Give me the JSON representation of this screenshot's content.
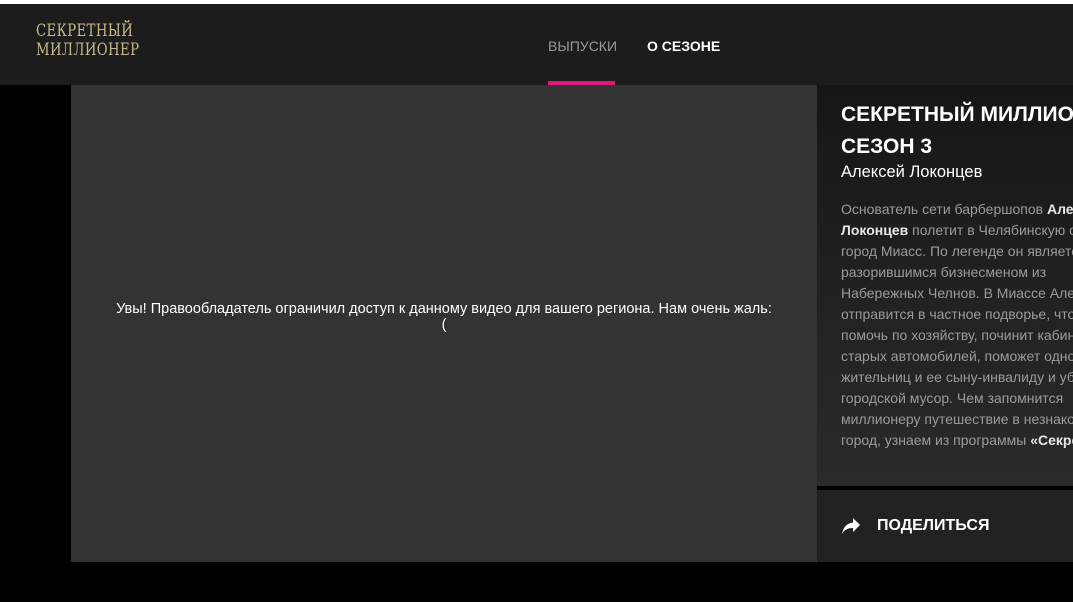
{
  "header": {
    "logo_line1": "СЕКРЕТНЫЙ",
    "logo_line2": "МИЛЛИОНЕР",
    "tabs": [
      {
        "label": "ВЫПУСКИ",
        "active": true
      },
      {
        "label": "О СЕЗОНЕ",
        "active": false
      }
    ]
  },
  "player": {
    "message": "Увы! Правообладатель ограничил доступ к данному видео для вашего региона. Нам очень жаль:("
  },
  "info": {
    "title_line1": "СЕКРЕТНЫЙ МИЛЛИОНЕР.",
    "title_line2": "СЕЗОН 3",
    "subtitle": "Алексей Локонцев",
    "description_lines": [
      {
        "plain": "Основатель сети барбершопов ",
        "bold": "Алексей"
      },
      {
        "plain": "",
        "bold": "Локонцев",
        "rest": " полетит в Челябинскую область, в"
      },
      {
        "plain": "город Миасс. По легенде он является"
      },
      {
        "plain": "разорившимся бизнесменом из"
      },
      {
        "plain": "Набережных Челнов. В Миассе Алексей"
      },
      {
        "plain": "отправится в частное подворье, чтобы"
      },
      {
        "plain": "помочь по хозяйству, починит кабины"
      },
      {
        "plain": "старых автомобилей, поможет одной из"
      },
      {
        "plain": "жительниц и ее сыну-инвалиду и уберет"
      },
      {
        "plain": "городской мусор. Чем запомнится"
      },
      {
        "plain": "миллионеру путешествие в незнакомый"
      },
      {
        "plain": "город, узнаем из программы ",
        "bold": "«Секретный миллионер»"
      }
    ]
  },
  "share": {
    "label": "ПОДЕЛИТЬСЯ",
    "icon": "share-arrow-icon"
  },
  "colors": {
    "accent": "#e0157a",
    "logo": "#c9b98a",
    "header_bg": "#1c1c1c",
    "player_bg": "#333333"
  }
}
